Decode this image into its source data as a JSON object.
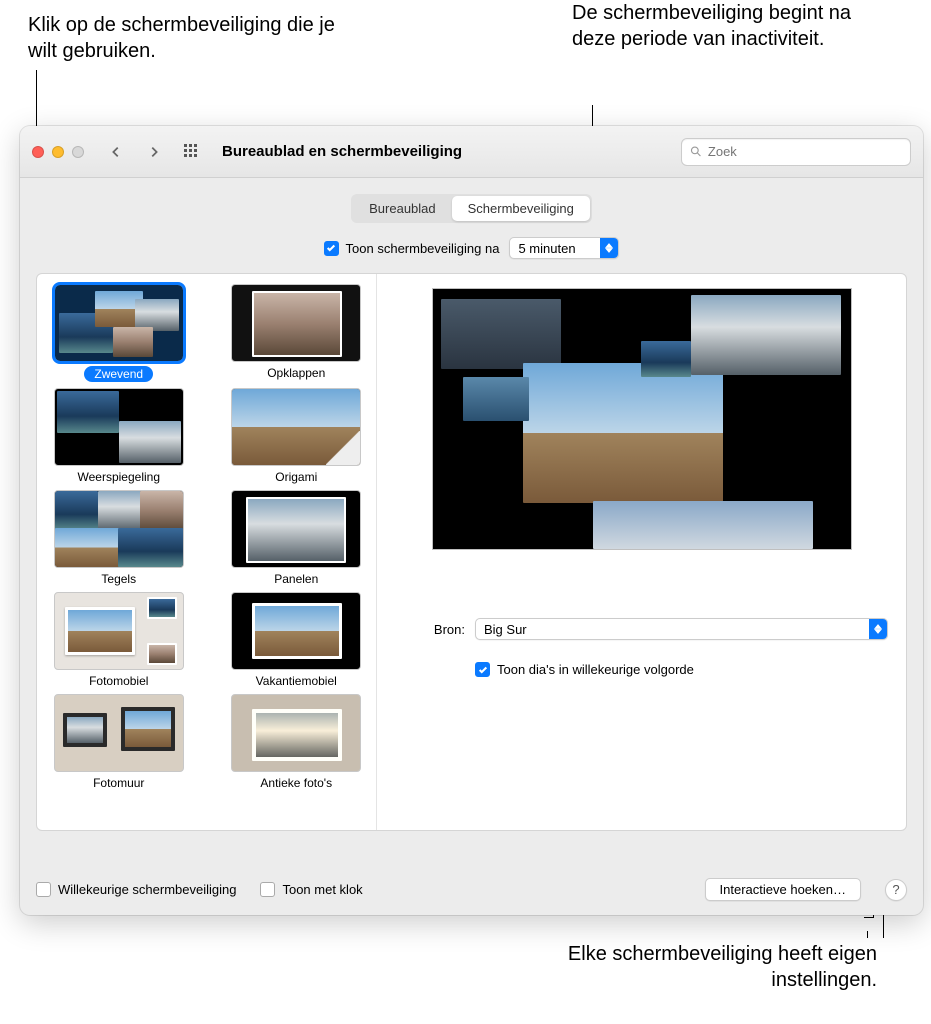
{
  "callouts": {
    "top_left": "Klik op de schermbeveiliging die je wilt gebruiken.",
    "top_right": "De schermbeveiliging begint na deze periode van inactiviteit.",
    "bottom_right": "Elke schermbeveiliging heeft eigen instellingen."
  },
  "toolbar": {
    "title": "Bureaublad en schermbeveiliging",
    "search_placeholder": "Zoek"
  },
  "tabs": {
    "desktop": "Bureaublad",
    "screensaver": "Schermbeveiliging"
  },
  "options": {
    "show_after_label": "Toon schermbeveiliging na",
    "show_after_value": "5 minuten",
    "source_label": "Bron:",
    "source_value": "Big Sur",
    "shuffle_label": "Toon dia's in willekeurige volgorde"
  },
  "screensavers": [
    "Zwevend",
    "Opklappen",
    "Weerspiegeling",
    "Origami",
    "Tegels",
    "Panelen",
    "Fotomobiel",
    "Vakantiemobiel",
    "Fotomuur",
    "Antieke foto's"
  ],
  "bottom": {
    "random": "Willekeurige schermbeveiliging",
    "clock": "Toon met klok",
    "hot_corners": "Interactieve hoeken…"
  }
}
